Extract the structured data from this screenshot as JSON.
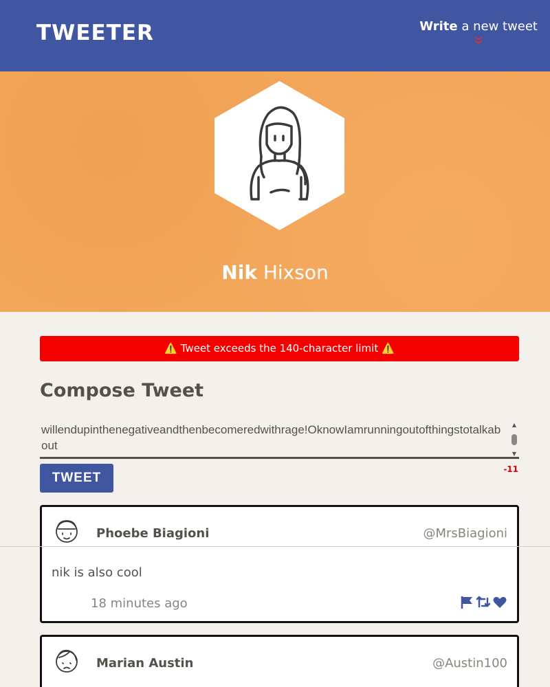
{
  "nav": {
    "logo": "TWEETER",
    "write_bold": "Write",
    "write_rest": " a new tweet",
    "chevron_icon": "double-chevron-down-icon"
  },
  "profile": {
    "first_name": "Nik",
    "last_name": "Hixson",
    "avatar_icon": "girl-avatar-icon"
  },
  "error": {
    "message": "⚠️ Tweet exceeds the 140-character limit ⚠️"
  },
  "compose": {
    "title": "Compose Tweet",
    "textarea_value": "willendupinthenegativeandthenbecomeredwithrage!OknowIamrunningoutofthingstotalkabout",
    "counter": "-11",
    "button_label": "TWEET"
  },
  "tweets": [
    {
      "name": "Phoebe Biagioni",
      "handle": "@MrsBiagioni",
      "content": "nik is also cool",
      "time": "18 minutes ago"
    },
    {
      "name": "Marian Austin",
      "handle": "@Austin100"
    }
  ],
  "colors": {
    "nav_bg": "#4056a1",
    "profile_bg": "#f2a65a",
    "error_bg": "#f40000",
    "page_bg": "#f4f1ec"
  }
}
